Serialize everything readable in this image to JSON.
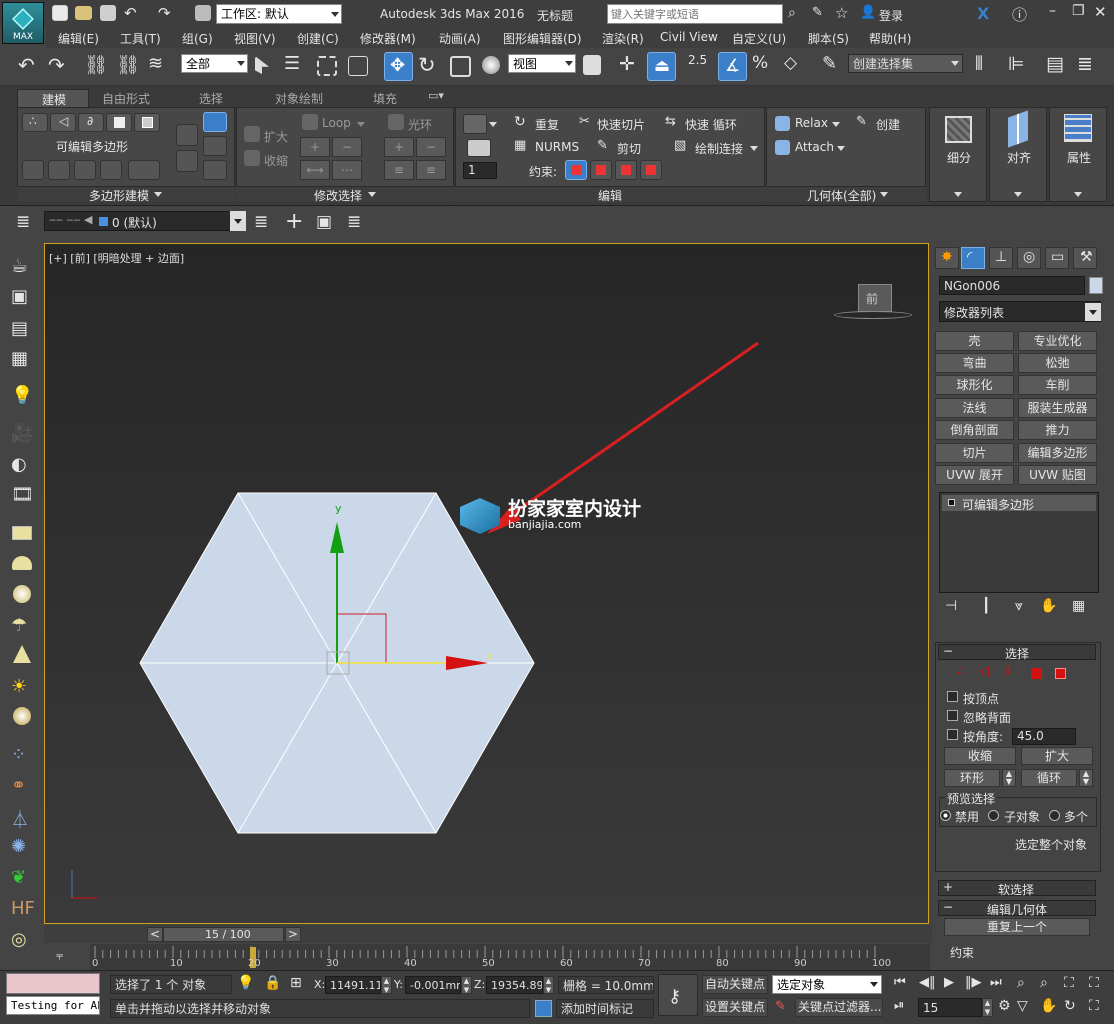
{
  "app": {
    "logo_text": "MAX",
    "workspace": "工作区: 默认",
    "title": "Autodesk 3ds Max 2016",
    "doc": "无标题",
    "search_placeholder": "键入关键字或短语",
    "login": "登录"
  },
  "menu": [
    "编辑(E)",
    "工具(T)",
    "组(G)",
    "视图(V)",
    "创建(C)",
    "修改器(M)",
    "动画(A)",
    "图形编辑器(D)",
    "渲染(R)",
    "Civil View",
    "自定义(U)",
    "脚本(S)",
    "帮助(H)"
  ],
  "toolbar": {
    "selection_filter": "全部",
    "ref_coord": "视图",
    "snap_angle": "2.5",
    "named_selection": "创建选择集"
  },
  "ribbon": {
    "tabs": [
      "建模",
      "自由形式",
      "选择",
      "对象绘制",
      "填充"
    ],
    "editable_poly": "可编辑多边形",
    "grow": "扩大",
    "shrink": "收缩",
    "loop": "Loop",
    "ring": "光环",
    "repeat": "重复",
    "quickslice": "快速切片",
    "quickloop": "快速 循环",
    "nurms": "NURMS",
    "cut": "剪切",
    "paint_connect": "绘制连接",
    "constraint": "约束:",
    "iter_value": "1",
    "relax": "Relax",
    "create": "创建",
    "attach": "Attach",
    "subdivide": "细分",
    "align": "对齐",
    "properties": "属性",
    "panel_poly": "多边形建模",
    "panel_modsel": "修改选择",
    "panel_edit": "编辑",
    "panel_geom": "几何体(全部)"
  },
  "layer": {
    "current": "0 (默认)"
  },
  "viewport": {
    "label": "[+] [前] [明暗处理 + 边面]",
    "viewcube": "前",
    "watermark_cn": "扮家家室内设计",
    "watermark_en": "banjiajia.com",
    "axis_x": "x",
    "axis_y": "y"
  },
  "cmdpanel": {
    "object_name": "NGon006",
    "mod_list": "修改器列表",
    "mod_buttons": [
      "壳",
      "专业优化",
      "弯曲",
      "松弛",
      "球形化",
      "车削",
      "法线",
      "服装生成器",
      "倒角剖面",
      "推力",
      "切片",
      "编辑多边形",
      "UVW 展开",
      "UVW 贴图"
    ],
    "stack_item": "可编辑多边形",
    "rollout_select": "选择",
    "by_vertex": "按顶点",
    "ignore_back": "忽略背面",
    "by_angle": "按角度:",
    "angle_value": "45.0",
    "shrink": "收缩",
    "grow": "扩大",
    "ring": "环形",
    "loop": "循环",
    "preview": "预览选择",
    "disable": "禁用",
    "subobject": "子对象",
    "multi": "多个",
    "select_whole": "选定整个对象",
    "soft_select": "软选择",
    "edit_geom": "编辑几何体",
    "repeat_last": "重复上一个",
    "constraints": "约束"
  },
  "timeline": {
    "frame": "15 / 100",
    "ticks": [
      "0",
      "10",
      "20",
      "30",
      "40",
      "50",
      "60",
      "70",
      "80",
      "90",
      "100"
    ],
    "current_frame": 15
  },
  "status": {
    "maxscript": "Testing for AL!",
    "selected": "选择了 1 个 对象",
    "hint": "单击并拖动以选择并移动对象",
    "x_label": "X:",
    "x": "11491.111",
    "y_label": "Y:",
    "y": "-0.001mm",
    "z_label": "Z:",
    "z": "19354.895",
    "grid": "栅格 = 10.0mm",
    "add_time_tag": "添加时间标记",
    "auto_key": "自动关键点",
    "set_key": "设置关键点",
    "selected_obj": "选定对象",
    "key_filter": "关键点过滤器...",
    "frame_field": "15"
  },
  "colors": {
    "accent_blue": "#3c7fc9",
    "gizmo_red": "#d41010",
    "gizmo_green": "#12a012",
    "mesh_fill": "#cad8ea",
    "viewport_bg": "#2c2c2c"
  }
}
